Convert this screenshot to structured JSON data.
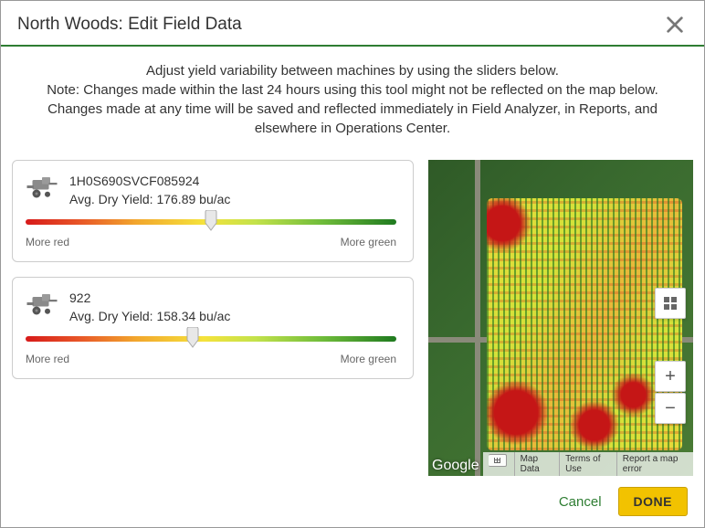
{
  "dialog": {
    "title": "North Woods: Edit Field Data",
    "intro_line1": "Adjust yield variability between machines by using the sliders below.",
    "intro_line2": "Note: Changes made within the last 24 hours using this tool might not be reflected on the map below. Changes made at any time will be saved and reflected immediately in Field Analyzer, in Reports, and elsewhere in Operations Center."
  },
  "machines": [
    {
      "name": "1H0S690SVCF085924",
      "yield_label": "Avg. Dry Yield: 176.89 bu/ac",
      "slider_position_pct": 50,
      "label_left": "More red",
      "label_right": "More green"
    },
    {
      "name": "922",
      "yield_label": "Avg. Dry Yield: 158.34 bu/ac",
      "slider_position_pct": 45,
      "label_left": "More red",
      "label_right": "More green"
    }
  ],
  "map": {
    "logo": "Google",
    "links": {
      "map_data": "Map Data",
      "terms": "Terms of Use",
      "report": "Report a map error"
    },
    "zoom_in": "+",
    "zoom_out": "−"
  },
  "buttons": {
    "cancel": "Cancel",
    "done": "DONE"
  }
}
